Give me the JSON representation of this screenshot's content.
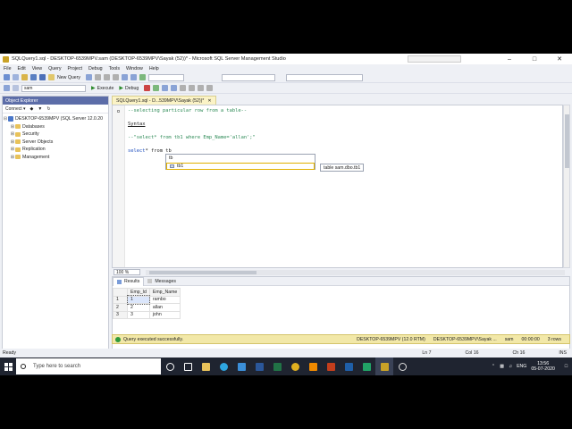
{
  "window": {
    "title": "SQLQuery1.sql - DESKTOP-6539MPV.sam (DESKTOP-6539MPV\\Sayak (52))* - Microsoft SQL Server Management Studio",
    "minimize": "–",
    "maximize": "□",
    "close": "✕"
  },
  "menu": [
    "File",
    "Edit",
    "View",
    "Query",
    "Project",
    "Debug",
    "Tools",
    "Window",
    "Help"
  ],
  "toolbar": {
    "new_query_label": "New Query",
    "database_value": "sam",
    "execute_label": "Execute",
    "debug_label": "Debug"
  },
  "object_explorer": {
    "title": "Object Explorer",
    "connect_label": "Connect ▾",
    "server": "DESKTOP-6539MPV (SQL Server 12.0.20",
    "nodes": [
      "Databases",
      "Security",
      "Server Objects",
      "Replication",
      "Management"
    ]
  },
  "editor": {
    "tab_label": "SQLQuery1.sql - D...539MPV\\Sayak (52))*",
    "tab_close": "✕",
    "line1": "--selecting particular row from a table--",
    "line2": "Syntax",
    "line3_comment": "--\"select* from tb1 where Emp_Name='allan';\"",
    "line4_kw": "select",
    "line4_rest": "* from tb",
    "intellisense": [
      "tb",
      "tb1"
    ],
    "tooltip": "table sam.dbo.tb1",
    "zoom": "100 %"
  },
  "results": {
    "tabs": [
      "Results",
      "Messages"
    ],
    "columns": [
      "Emp_Id",
      "Emp_Name"
    ],
    "rows": [
      {
        "n": "1",
        "id": "1",
        "name": "rambo"
      },
      {
        "n": "2",
        "id": "2",
        "name": "allan"
      },
      {
        "n": "3",
        "id": "3",
        "name": "john"
      }
    ]
  },
  "query_status": {
    "message": "Query executed successfully.",
    "server": "DESKTOP-6539MPV (12.0 RTM)",
    "user": "DESKTOP-6539MPV\\Sayak ...",
    "db": "sam",
    "time": "00:00:00",
    "rows": "3 rows"
  },
  "app_status": {
    "ready": "Ready",
    "ln": "Ln 7",
    "col": "Col 16",
    "ch": "Ch 16",
    "ins": "INS"
  },
  "taskbar": {
    "search_placeholder": "Type here to search",
    "lang": "ENG",
    "time": "13:56",
    "date": "05-07-2020"
  },
  "colors": {
    "titlebar_oe": "#5c6da8",
    "status_yellow": "#f2e8a8",
    "taskbar": "#1f2430"
  }
}
